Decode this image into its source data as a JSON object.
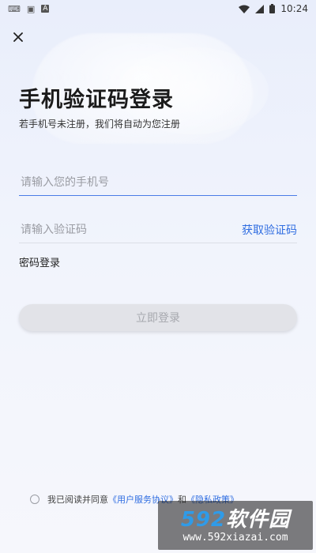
{
  "status_bar": {
    "time": "10:24",
    "left_icons": [
      "keyboard-icon",
      "sim-icon",
      "notification-a-icon"
    ],
    "right_icons": [
      "wifi-icon",
      "signal-icon",
      "battery-icon"
    ]
  },
  "header": {
    "close_icon": "close-icon"
  },
  "login": {
    "title": "手机验证码登录",
    "subtitle": "若手机号未注册，我们将自动为您注册",
    "phone_placeholder": "请输入您的手机号",
    "code_placeholder": "请输入验证码",
    "get_code_label": "获取验证码",
    "password_login_label": "密码登录",
    "submit_label": "立即登录"
  },
  "agreement": {
    "prefix": "我已阅读并同意",
    "user_agreement": "《用户服务协议》",
    "and": "和",
    "privacy_policy": "《隐私政策》"
  },
  "watermark": {
    "logo_num": "592",
    "logo_text": "软件园",
    "url": "www.592xiazai.com"
  },
  "colors": {
    "accent": "#2f6de1",
    "input_focus_line": "#4a7be6",
    "disabled_button": "#e2e3e8"
  }
}
